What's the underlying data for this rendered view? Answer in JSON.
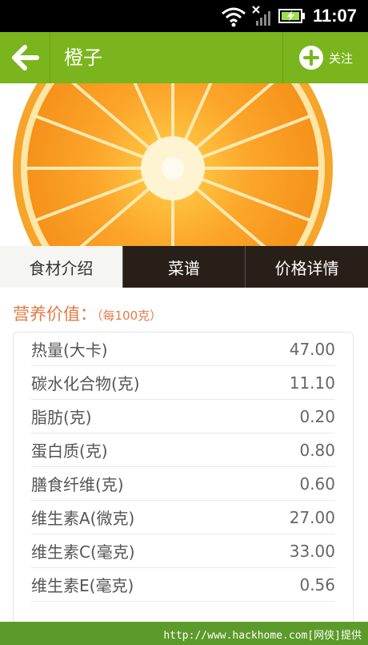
{
  "status_bar": {
    "time": "11:07",
    "icons": [
      "wifi-icon",
      "no-signal-icon",
      "battery-charging-icon"
    ]
  },
  "app_bar": {
    "back_icon": "arrow-left-icon",
    "title": "橙子",
    "follow_label": "关注",
    "follow_icon": "plus-circle-icon"
  },
  "hero_image": {
    "subject": "orange-slice"
  },
  "tabs": [
    {
      "label": "食材介绍",
      "active": true
    },
    {
      "label": "菜谱",
      "active": false
    },
    {
      "label": "价格详情",
      "active": false
    }
  ],
  "nutrition": {
    "title": "营养价值：",
    "subtitle": "（每100克）",
    "rows": [
      {
        "name": "热量(大卡)",
        "value": "47.00"
      },
      {
        "name": "碳水化合物(克)",
        "value": "11.10"
      },
      {
        "name": "脂肪(克)",
        "value": "0.20"
      },
      {
        "name": "蛋白质(克)",
        "value": "0.80"
      },
      {
        "name": "膳食纤维(克)",
        "value": "0.60"
      },
      {
        "name": "维生素A(微克)",
        "value": "27.00"
      },
      {
        "name": "维生素C(毫克)",
        "value": "33.00"
      },
      {
        "name": "维生素E(毫克)",
        "value": "0.56"
      }
    ]
  },
  "watermark": {
    "text": "http://www.hackhome.com[网侠]提供"
  },
  "colors": {
    "app_bar": "#7ab51d",
    "accent_title": "#e57a45",
    "footer": "#5c9a2a"
  }
}
